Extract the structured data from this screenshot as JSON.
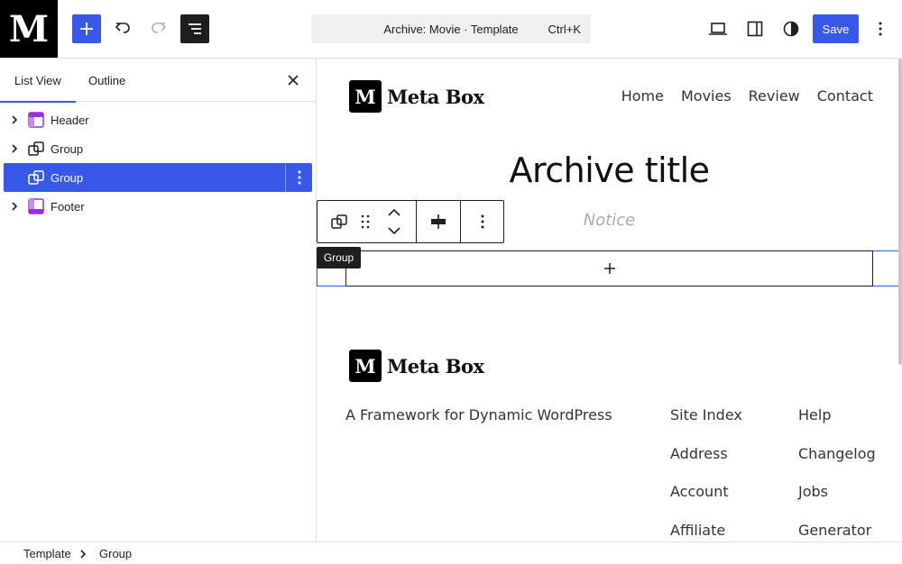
{
  "app": {
    "logo_letter": "M"
  },
  "topbar": {
    "command_title": "Archive: Movie · Template",
    "command_shortcut": "Ctrl+K",
    "save_label": "Save",
    "accent_color": "#3858e9"
  },
  "panel": {
    "tabs": [
      {
        "label": "List View",
        "active": true
      },
      {
        "label": "Outline",
        "active": false
      }
    ],
    "items": [
      {
        "label": "Header",
        "icon": "template-part-header-icon",
        "expandable": true,
        "selected": false
      },
      {
        "label": "Group",
        "icon": "group-icon",
        "expandable": true,
        "selected": false
      },
      {
        "label": "Group",
        "icon": "group-icon",
        "expandable": false,
        "selected": true
      },
      {
        "label": "Footer",
        "icon": "template-part-footer-icon",
        "expandable": true,
        "selected": false
      }
    ]
  },
  "canvas": {
    "brand_letter": "M",
    "brand_name": "Meta Box",
    "nav": [
      "Home",
      "Movies",
      "Review",
      "Contact"
    ],
    "archive_title": "Archive title",
    "notice": "Notice",
    "tooltip": "Group",
    "footer": {
      "tagline": "A Framework for Dynamic WordPress",
      "col1": [
        "Site Index",
        "Address",
        "Account",
        "Affiliate"
      ],
      "col2": [
        "Help",
        "Changelog",
        "Jobs",
        "Generator"
      ]
    }
  },
  "breadcrumbs": [
    "Template",
    "Group"
  ]
}
